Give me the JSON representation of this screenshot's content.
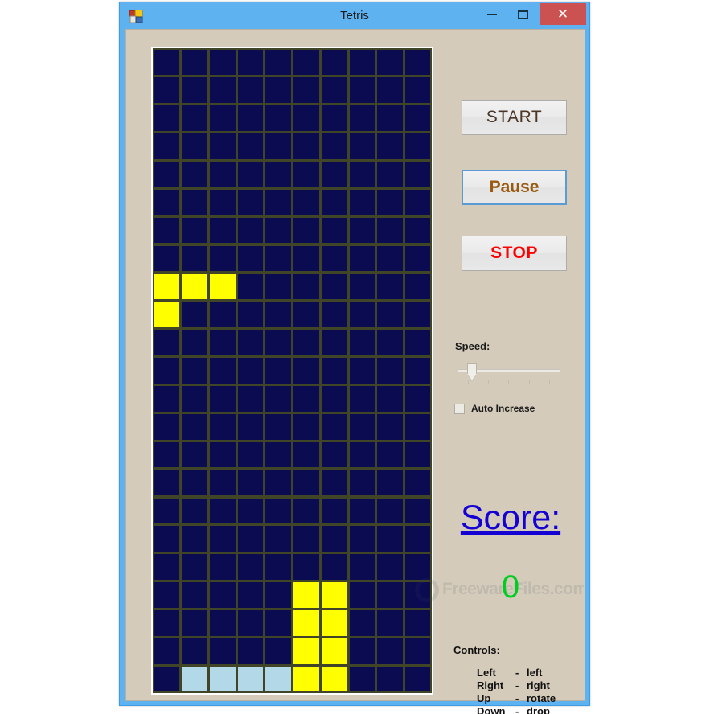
{
  "window": {
    "title": "Tetris",
    "icon": "app-form-icon",
    "controls": {
      "minimize": "minimize-icon",
      "maximize": "maximize-icon",
      "close": "✕"
    }
  },
  "colors": {
    "titlebar": "#5fb2f0",
    "form_background": "#d4cbba",
    "board_background": "#0b0b52",
    "board_grid": "#3f4526",
    "piece_yellow": "#ffff00",
    "piece_lightblue": "#b3d9e8",
    "close_button": "#cc5252",
    "score_label": "#1500d4",
    "score_value": "#00cc22",
    "stop_text": "#ff0000",
    "pause_text": "#9a5a11",
    "start_text": "#4a3526",
    "focus_border": "#5b9bd5"
  },
  "buttons": {
    "start": "START",
    "pause": "Pause",
    "stop": "STOP"
  },
  "speed": {
    "label": "Speed:",
    "slider_position_percent": 10,
    "tick_count": 11
  },
  "auto_increase": {
    "label": "Auto Increase",
    "checked": false
  },
  "score": {
    "label": "Score:",
    "value": "0"
  },
  "controls": {
    "title": "Controls:",
    "rows": [
      {
        "key": "Left",
        "dash": "-",
        "action": "left"
      },
      {
        "key": "Right",
        "dash": "-",
        "action": "right"
      },
      {
        "key": "Up",
        "dash": "-",
        "action": "rotate"
      },
      {
        "key": "Down",
        "dash": "-",
        "action": "drop"
      }
    ]
  },
  "watermark": {
    "text": "FreewareFiles.com"
  },
  "board": {
    "columns": 10,
    "rows": 23,
    "cell_size": 34.7,
    "active_piece": {
      "type": "J",
      "color": "#ffff00",
      "cells": [
        [
          0,
          8
        ],
        [
          1,
          8
        ],
        [
          2,
          8
        ],
        [
          0,
          9
        ]
      ]
    },
    "stack": [
      {
        "color": "#ffff00",
        "cells": [
          [
            5,
            19
          ],
          [
            6,
            19
          ],
          [
            5,
            20
          ],
          [
            6,
            20
          ],
          [
            5,
            21
          ],
          [
            6,
            21
          ],
          [
            5,
            22
          ],
          [
            6,
            22
          ]
        ]
      },
      {
        "color": "#b3d9e8",
        "cells": [
          [
            1,
            22
          ],
          [
            2,
            22
          ],
          [
            3,
            22
          ],
          [
            4,
            22
          ]
        ]
      }
    ]
  }
}
